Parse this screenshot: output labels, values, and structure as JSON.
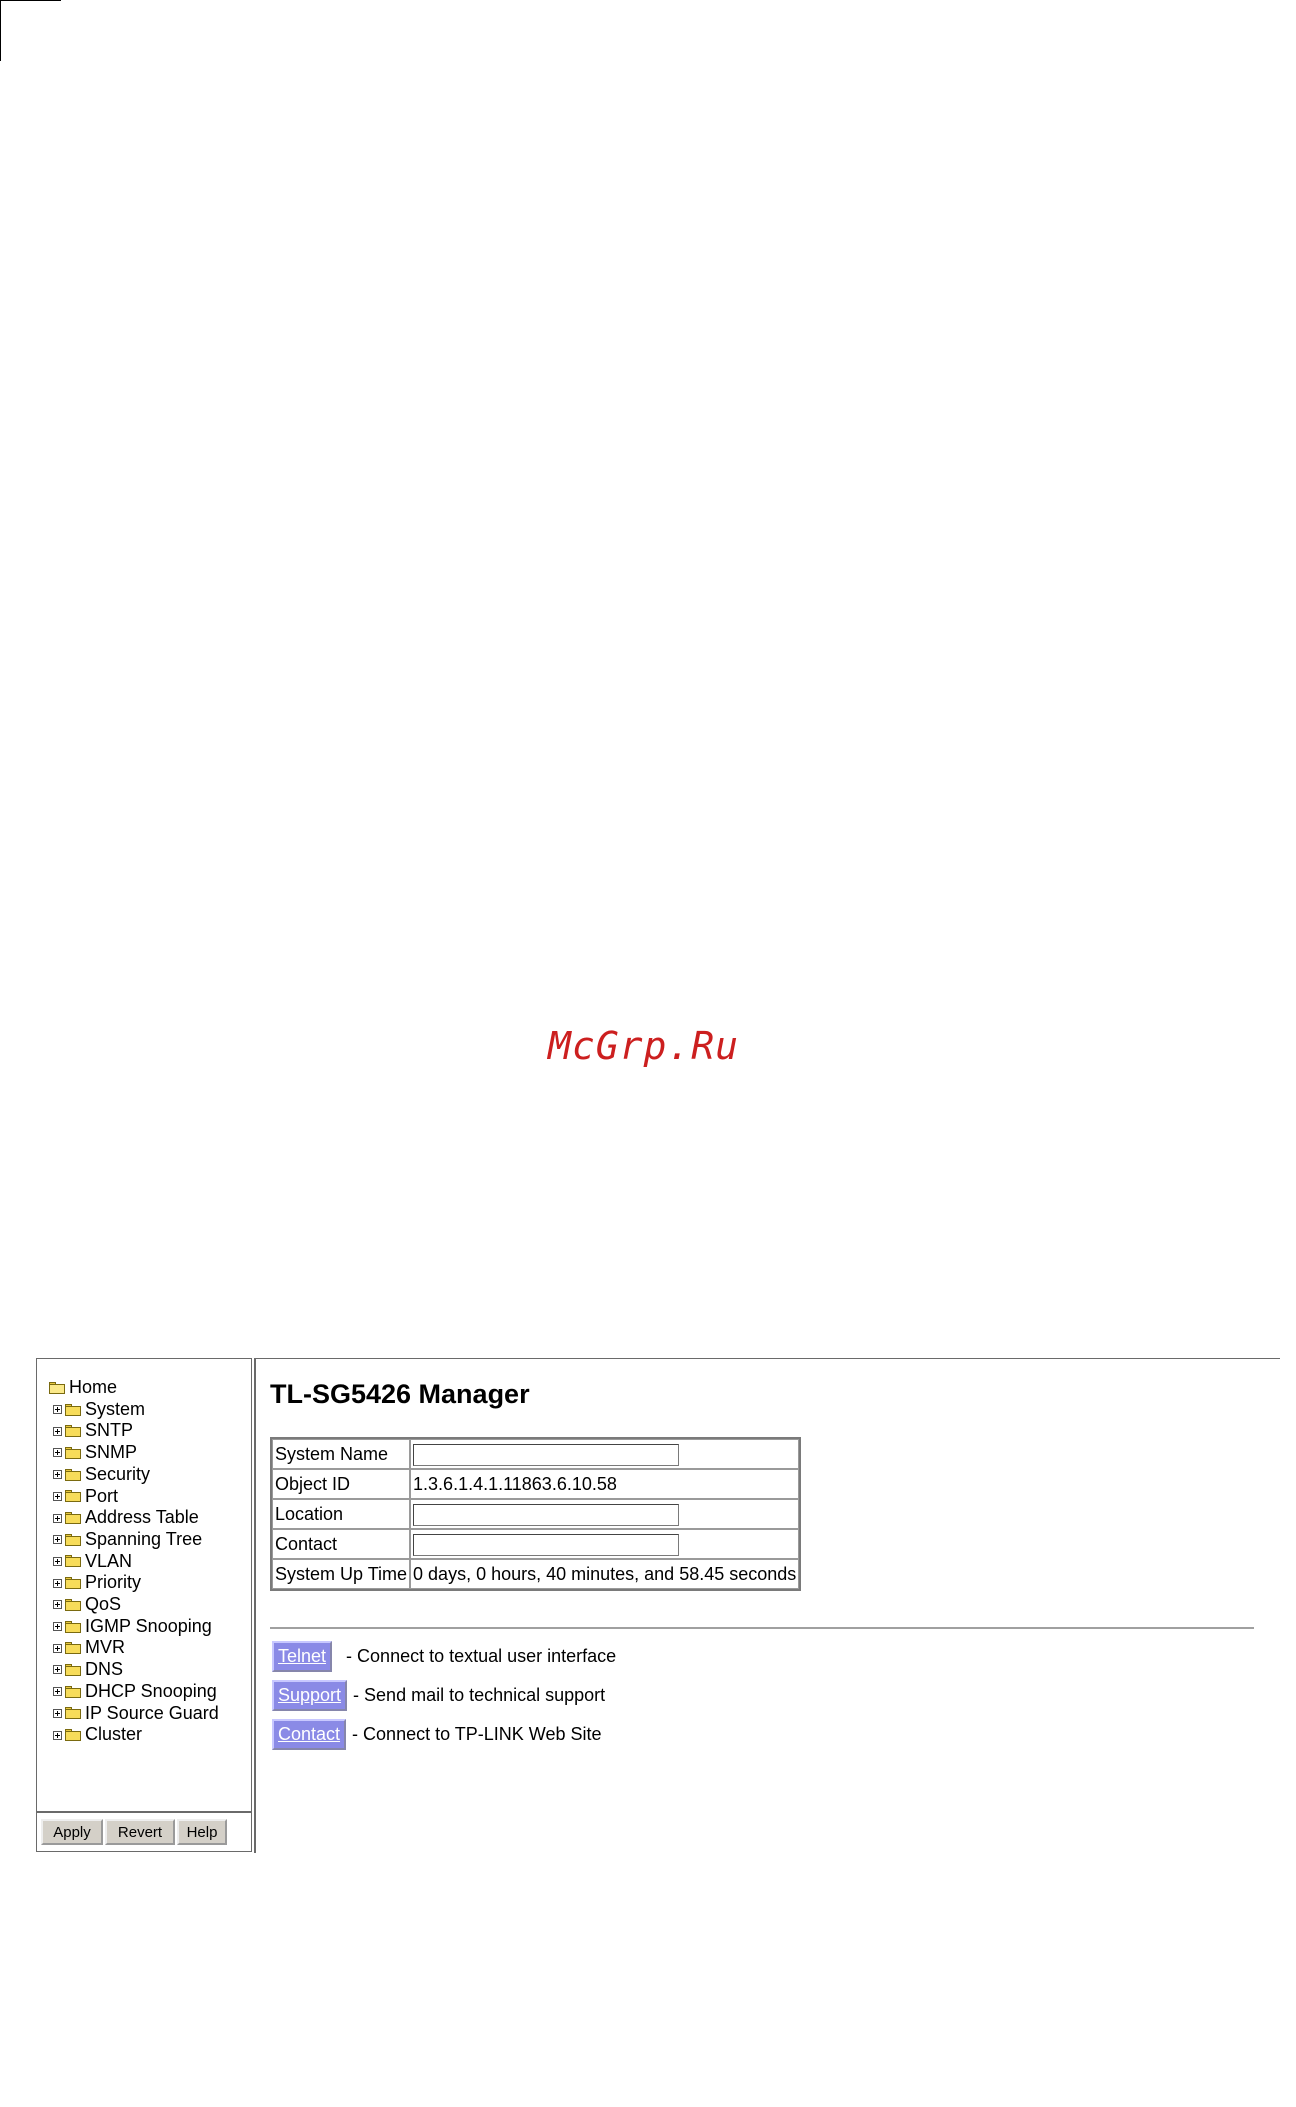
{
  "watermark": "McGrp.Ru",
  "tree": {
    "root": "Home",
    "items": [
      "System",
      "SNTP",
      "SNMP",
      "Security",
      "Port",
      "Address Table",
      "Spanning Tree",
      "VLAN",
      "Priority",
      "QoS",
      "IGMP Snooping",
      "MVR",
      "DNS",
      "DHCP Snooping",
      "IP Source Guard",
      "Cluster"
    ]
  },
  "left_buttons": {
    "apply": "Apply",
    "revert": "Revert",
    "help": "Help"
  },
  "main": {
    "title": "TL-SG5426 Manager",
    "rows": {
      "system_name": {
        "label": "System Name",
        "value": ""
      },
      "object_id": {
        "label": "Object ID",
        "value": "1.3.6.1.4.1.11863.6.10.58"
      },
      "location": {
        "label": "Location",
        "value": ""
      },
      "contact": {
        "label": "Contact",
        "value": ""
      },
      "uptime": {
        "label": "System Up Time",
        "value": "0 days, 0 hours, 40 minutes, and 58.45 seconds"
      }
    },
    "links": [
      {
        "label": "Telnet",
        "desc": "- Connect to textual user interface"
      },
      {
        "label": "Support",
        "desc": "- Send mail to technical support"
      },
      {
        "label": "Contact",
        "desc": "- Connect to TP-LINK Web Site"
      }
    ]
  },
  "colors": {
    "link_bg": "#8a8ae6",
    "watermark": "#cc1f1f",
    "button_bg": "#d4d0c8"
  }
}
